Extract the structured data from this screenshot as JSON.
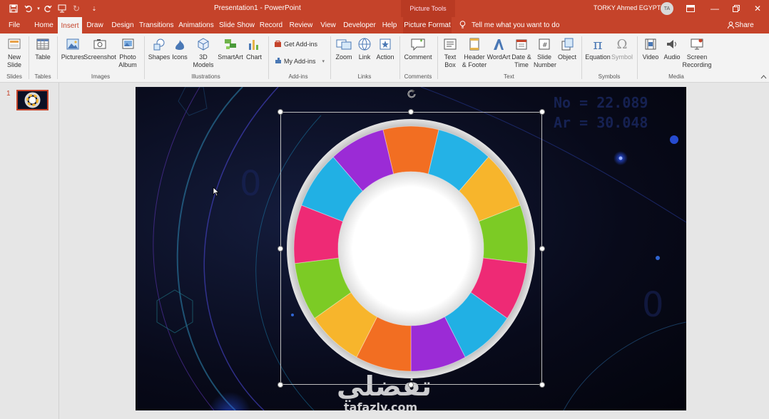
{
  "titlebar": {
    "title": "Presentation1 - PowerPoint",
    "context_tab_group": "Picture Tools",
    "user": "TORKY Ahmed EGYPT 1",
    "avatar_initials": "TA"
  },
  "tabs": [
    "File",
    "Home",
    "Insert",
    "Draw",
    "Design",
    "Transitions",
    "Animations",
    "Slide Show",
    "Record",
    "Review",
    "View",
    "Developer",
    "Help",
    "Picture Format"
  ],
  "active_tab": "Insert",
  "tell_me": "Tell me what you want to do",
  "share": "Share",
  "ribbon": {
    "new_slide": "New Slide",
    "table": "Table",
    "pictures": "Pictures",
    "screenshot": "Screenshot",
    "photo_album": "Photo Album",
    "shapes": "Shapes",
    "icons": "Icons",
    "models_3d": "3D Models",
    "smartart": "SmartArt",
    "chart": "Chart",
    "get_addins": "Get Add-ins",
    "my_addins": "My Add-ins",
    "zoom": "Zoom",
    "link": "Link",
    "action": "Action",
    "comment": "Comment",
    "text_box": "Text Box",
    "header_footer": "Header & Footer",
    "wordart": "WordArt",
    "date_time": "Date & Time",
    "slide_number": "Slide Number",
    "object": "Object",
    "equation": "Equation",
    "symbol": "Symbol",
    "video": "Video",
    "audio": "Audio",
    "screen_recording": "Screen Recording",
    "groups": {
      "slides": "Slides",
      "tables": "Tables",
      "images": "Images",
      "illustrations": "Illustrations",
      "addins": "Add-ins",
      "links": "Links",
      "comments": "Comments",
      "text": "Text",
      "symbols": "Symbols",
      "media": "Media"
    }
  },
  "slide_number": "1",
  "slide_text": {
    "no_line": "No = 22.089",
    "ar_line": "Ar = 30.048",
    "digit_a": "0",
    "digit_b": "0"
  },
  "watermark": {
    "arabic": "تفضلي",
    "latin": "tafazly.com"
  },
  "wheel_colors": [
    "#f26e22",
    "#24b2e6",
    "#f7b52c",
    "#7ccb25",
    "#ee2a75",
    "#21b0e4",
    "#9b2bd6",
    "#f26e22",
    "#f7b52c",
    "#7ccb25",
    "#ee2a75",
    "#21b0e4",
    "#9b2bd6"
  ]
}
